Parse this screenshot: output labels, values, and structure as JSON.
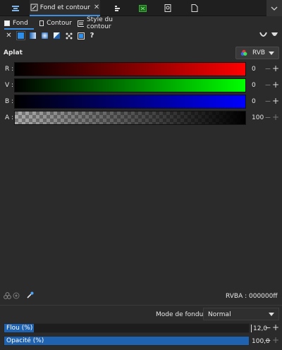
{
  "dock": {
    "active_tab_label": "Fond et contour",
    "tabs": [
      {
        "icon": "align-icon"
      },
      {
        "icon": "fill-stroke-icon",
        "label": "Fond et contour"
      },
      {
        "icon": "layers-icon"
      },
      {
        "icon": "export-image-icon"
      },
      {
        "icon": "document-properties-icon"
      },
      {
        "icon": "new-document-icon"
      }
    ]
  },
  "subtabs": {
    "fill": "Fond",
    "stroke": "Contour",
    "stroke_style": "Style du contour"
  },
  "paint_types": [
    "no-paint",
    "flat",
    "linear-gradient",
    "radial-gradient",
    "mesh",
    "pattern",
    "swatch",
    "unset"
  ],
  "unset_label": "?",
  "section_title": "Aplat",
  "color_mode": "RVB",
  "channels": [
    {
      "label": "R :",
      "value": "0",
      "color": "#ff0000"
    },
    {
      "label": "V :",
      "value": "0",
      "color": "#00ff00"
    },
    {
      "label": "B :",
      "value": "0",
      "color": "#0000ff"
    },
    {
      "label": "A :",
      "value": "100",
      "color": "#000000"
    }
  ],
  "rgba": {
    "label": "RVBA :",
    "value": "000000ff"
  },
  "blend": {
    "label": "Mode de fondu :",
    "value": "Normal"
  },
  "blur": {
    "label": "Flou (%)",
    "value": "12,0",
    "fraction": 0.12
  },
  "opacity": {
    "label": "Opacité (%)",
    "value": "100,0",
    "fraction": 1.0
  },
  "colors": {
    "accent": "#3d8ee0",
    "fill_bar": "#1e62b0",
    "background": "#2b2b2b"
  }
}
